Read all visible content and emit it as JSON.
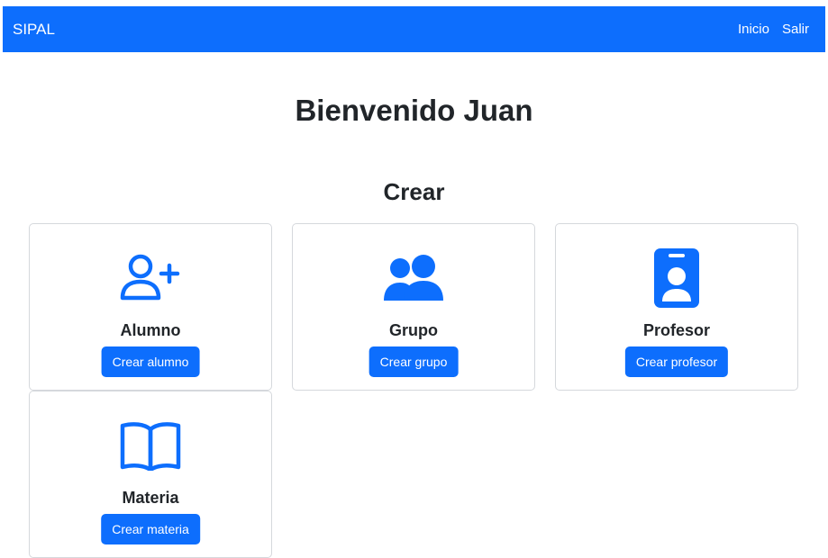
{
  "navbar": {
    "brand": "SIPAL",
    "links": [
      "Inicio",
      "Salir"
    ]
  },
  "welcome": "Bienvenido Juan",
  "section_title": "Crear",
  "cards": [
    {
      "title": "Alumno",
      "button": "Crear alumno",
      "icon": "person-plus-icon"
    },
    {
      "title": "Grupo",
      "button": "Crear grupo",
      "icon": "people-icon"
    },
    {
      "title": "Profesor",
      "button": "Crear profesor",
      "icon": "person-badge-icon"
    },
    {
      "title": "Materia",
      "button": "Crear materia",
      "icon": "book-icon"
    }
  ],
  "colors": {
    "primary": "#0d6efd",
    "text": "#212529",
    "border": "#d5d8dc"
  }
}
